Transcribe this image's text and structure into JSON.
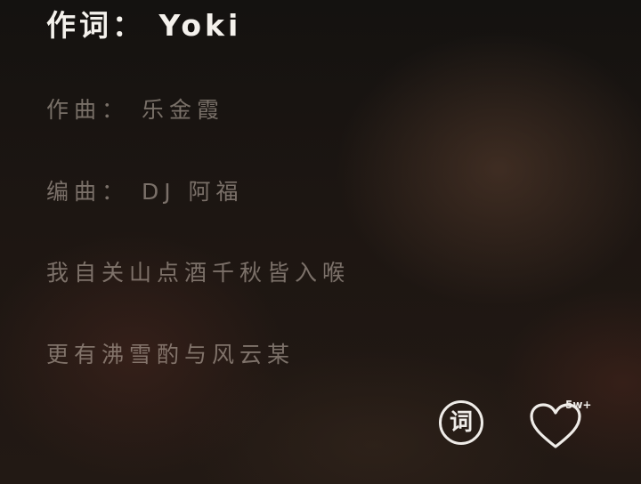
{
  "lyrics": {
    "lines": [
      "作词： Yoki",
      "作曲： 乐金霞",
      "编曲： DJ 阿福",
      "我自关山点酒千秋皆入喉",
      "更有沸雪酌与风云某"
    ],
    "current_index": 0
  },
  "controls": {
    "lyrics_button_label": "词",
    "like_count": "5w+",
    "lyrics_icon": "lyrics-icon",
    "like_icon": "heart-outline-icon"
  },
  "colors": {
    "text_active": "#f4f1ec",
    "text_inactive": "#c8bcb0",
    "icon": "#efece8"
  }
}
